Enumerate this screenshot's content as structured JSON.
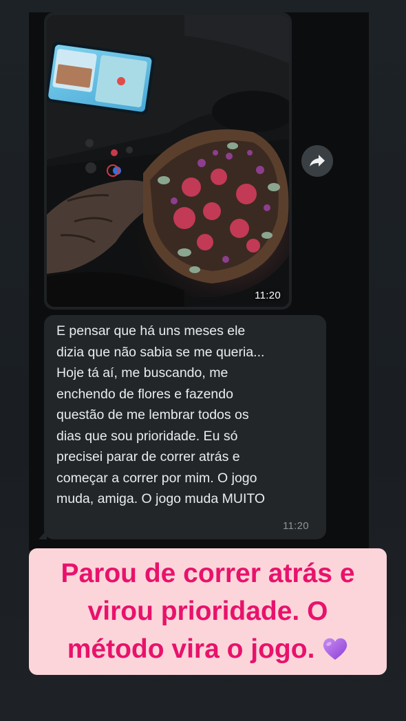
{
  "chat": {
    "photo_message": {
      "time": "11:20"
    },
    "text_message": {
      "text": "E pensar que há uns meses ele\ndizia que não sabia se me queria...\nHoje tá aí, me buscando, me\nenchendo de flores e fazendo\nquestão de me lembrar todos os\ndias que sou prioridade. Eu só\nprecisei parar de correr atrás e\ncomeçar a correr por mim. O jogo\nmuda, amiga. O jogo muda MUITO",
      "time": "11:20"
    },
    "forward_icon": "forward-arrow-icon"
  },
  "caption": {
    "text": "Parou de correr atrás e\nvirou prioridade. O\nmétodo vira o jogo.",
    "emoji_icon": "purple-heart-icon",
    "color": "#e8126b",
    "background": "#fcd5da"
  },
  "colors": {
    "bubble": "#232628",
    "message_text": "#e9edef",
    "timestamp": "#8d9398"
  }
}
